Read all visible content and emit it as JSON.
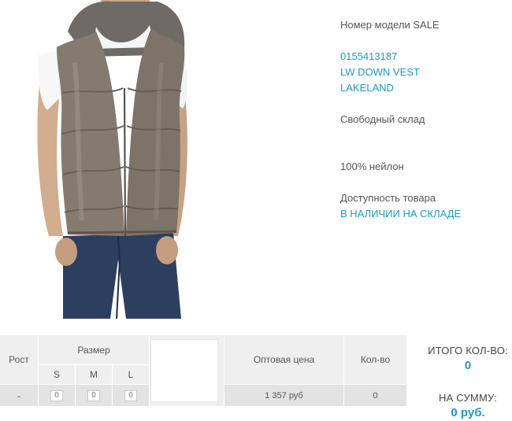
{
  "product": {
    "model_label": "Номер модели SALE",
    "code": "0155413187",
    "name": "LW DOWN VEST",
    "brand": "LAKELAND",
    "stock": "Свободный склад",
    "material": "100% нейлон",
    "availability_label": "Доступность товара",
    "availability_value": "В НАЛИЧИИ НА СКЛАДЕ"
  },
  "order_table": {
    "headers": {
      "height": "Рост",
      "size": "Размер",
      "price": "Оптовая цена",
      "qty": "Кол-во"
    },
    "sizes": [
      "S",
      "M",
      "L"
    ],
    "row": {
      "height": "-",
      "qty_values": [
        "0",
        "0",
        "0"
      ],
      "price": "1 357 руб",
      "qty": "0"
    }
  },
  "totals": {
    "total_qty_label": "ИТОГО КОЛ-ВО:",
    "total_qty_value": "0",
    "total_sum_label": "НА СУММУ:",
    "total_sum_value": "0 руб."
  },
  "colors": {
    "accent": "#1a9bc4",
    "table_bg": "#efefef",
    "text": "#555555"
  }
}
